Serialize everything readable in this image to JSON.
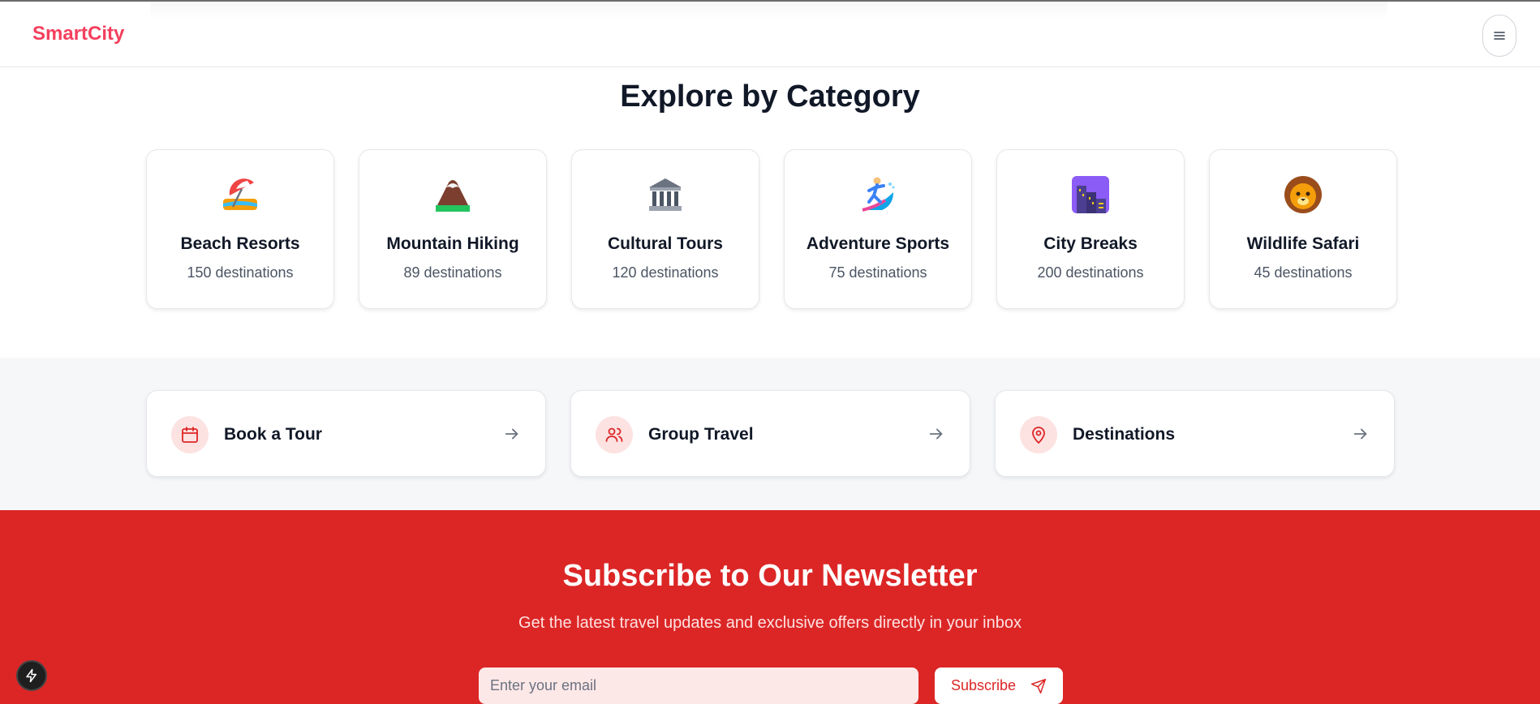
{
  "header": {
    "brand": "SmartCity",
    "menu_icon": "hamburger-menu-icon",
    "brand_color": "#f43f5e"
  },
  "categories": {
    "title": "Explore by Category",
    "items": [
      {
        "name": "Beach Resorts",
        "count": "150 destinations",
        "icon": "beach-umbrella-icon"
      },
      {
        "name": "Mountain Hiking",
        "count": "89 destinations",
        "icon": "mountain-icon"
      },
      {
        "name": "Cultural Tours",
        "count": "120 destinations",
        "icon": "classical-building-icon"
      },
      {
        "name": "Adventure Sports",
        "count": "75 destinations",
        "icon": "surfer-icon"
      },
      {
        "name": "City Breaks",
        "count": "200 destinations",
        "icon": "night-city-icon"
      },
      {
        "name": "Wildlife Safari",
        "count": "45 destinations",
        "icon": "lion-face-icon"
      }
    ]
  },
  "quick_links": [
    {
      "label": "Book a Tour",
      "icon": "calendar-icon"
    },
    {
      "label": "Group Travel",
      "icon": "users-icon"
    },
    {
      "label": "Destinations",
      "icon": "map-pin-icon"
    }
  ],
  "newsletter": {
    "title": "Subscribe to Our Newsletter",
    "subtitle": "Get the latest travel updates and exclusive offers directly in your inbox",
    "email_placeholder": "Enter your email",
    "email_value": "",
    "subscribe_label": "Subscribe",
    "accent_color": "#dc2626"
  }
}
